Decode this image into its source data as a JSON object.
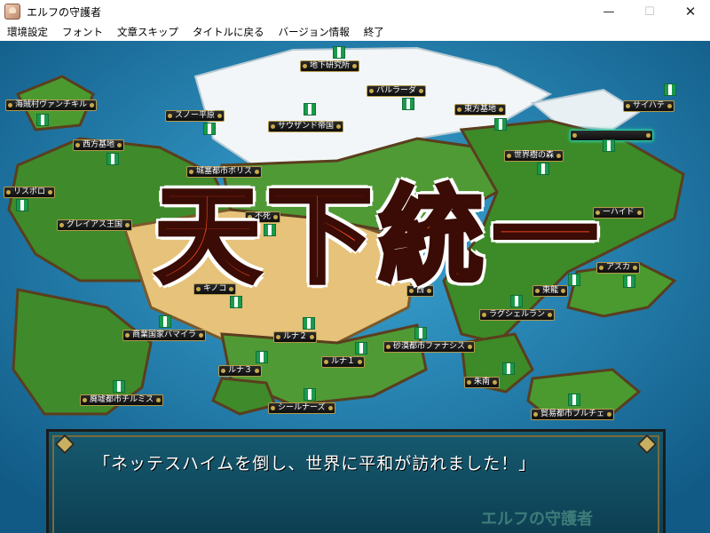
{
  "window": {
    "title": "エルフの守護者",
    "minimize": "—",
    "maximize": "☐",
    "close": "✕"
  },
  "menu": [
    "環境設定",
    "フォント",
    "文章スキップ",
    "タイトルに戻る",
    "バージョン情報",
    "終了"
  ],
  "locations": {
    "chika": "地下研究所",
    "barurada": "バルラーダ",
    "kaizoku": "海賊村ヴァンチキル",
    "snow": "スノー平原",
    "sausand": "サウザンド帝国",
    "higashi": "東方基地",
    "saihate": "サイハテ",
    "nishi": "西方基地",
    "sekaiju": "世界樹の森",
    "jokaku": "城塞都市ボリス",
    "risupolo": "リスポロ",
    "greias": "グレイアス王国",
    "fushi": "不死",
    "haido": "ーハイド",
    "asuka": "アスカ",
    "kinoko": "キノコ",
    "nishi2": "西",
    "toryu": "東龍",
    "rague": "ラグシェルラン",
    "shogyo": "商業国家バマイラ",
    "runa2": "ルナ２",
    "sabaku": "砂漠都市ファナシス",
    "runa1": "ルナ１",
    "runa3": "ルナ３",
    "shunan": "朱南",
    "haikyo": "廃墟都市チルミス",
    "seal": "シールナーズ",
    "boeki": "貿易都市ブルチェ"
  },
  "banner": [
    "天",
    "下",
    "統",
    "一"
  ],
  "dialogue": "「ネッテスハイムを倒し、世界に平和が訪れました！」",
  "watermark": "エルフの守護者",
  "colors": {
    "ocean": "#1f7fb0",
    "forest": "#3f8a2a",
    "desert": "#e6c27a",
    "snow": "#f2f6f8",
    "banner_fill": "#e8421c"
  }
}
